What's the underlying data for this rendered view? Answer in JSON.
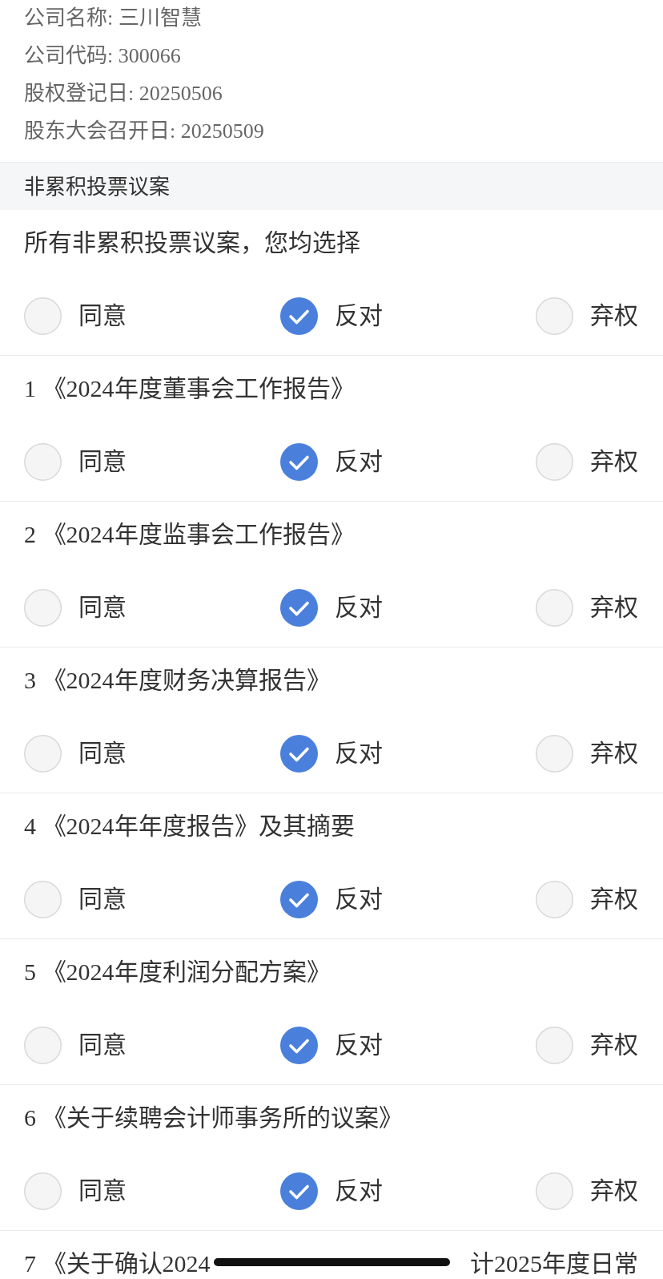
{
  "info_lines": [
    "公司名称: 三川智慧",
    "公司代码: 300066",
    "股权登记日: 20250506",
    "股东大会召开日: 20250509"
  ],
  "section": {
    "title": "非累积投票议案"
  },
  "bulk_vote": {
    "prompt": "所有非累积投票议案，您均选择",
    "options": [
      {
        "label": "同意",
        "selected": false
      },
      {
        "label": "反对",
        "selected": true
      },
      {
        "label": "弃权",
        "selected": false
      }
    ]
  },
  "proposals": [
    {
      "title": "1 《2024年度董事会工作报告》",
      "options": [
        {
          "label": "同意",
          "selected": false
        },
        {
          "label": "反对",
          "selected": true
        },
        {
          "label": "弃权",
          "selected": false
        }
      ]
    },
    {
      "title": "2 《2024年度监事会工作报告》",
      "options": [
        {
          "label": "同意",
          "selected": false
        },
        {
          "label": "反对",
          "selected": true
        },
        {
          "label": "弃权",
          "selected": false
        }
      ]
    },
    {
      "title": "3 《2024年度财务决算报告》",
      "options": [
        {
          "label": "同意",
          "selected": false
        },
        {
          "label": "反对",
          "selected": true
        },
        {
          "label": "弃权",
          "selected": false
        }
      ]
    },
    {
      "title": "4 《2024年年度报告》及其摘要",
      "options": [
        {
          "label": "同意",
          "selected": false
        },
        {
          "label": "反对",
          "selected": true
        },
        {
          "label": "弃权",
          "selected": false
        }
      ]
    },
    {
      "title": "5 《2024年度利润分配方案》",
      "options": [
        {
          "label": "同意",
          "selected": false
        },
        {
          "label": "反对",
          "selected": true
        },
        {
          "label": "弃权",
          "selected": false
        }
      ]
    },
    {
      "title": "6 《关于续聘会计师事务所的议案》",
      "options": [
        {
          "label": "同意",
          "selected": false
        },
        {
          "label": "反对",
          "selected": true
        },
        {
          "label": "弃权",
          "selected": false
        }
      ]
    },
    {
      "title_parts": [
        "7 《关于确认2024",
        "计2025年度日常"
      ]
    }
  ]
}
